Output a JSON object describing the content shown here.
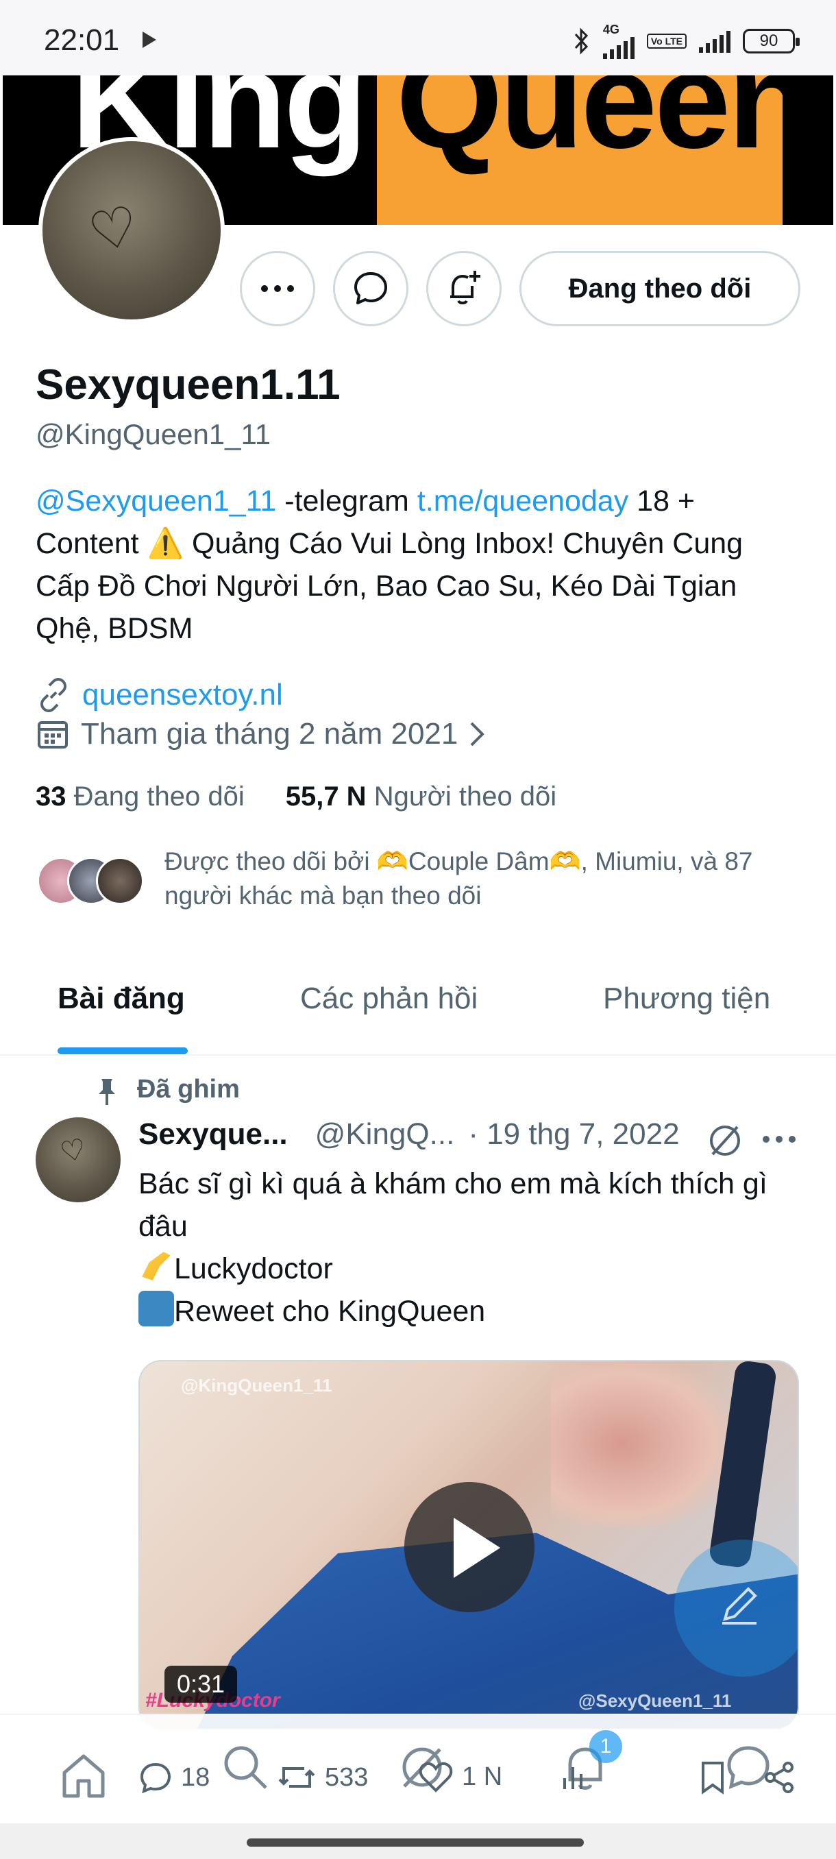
{
  "status_bar": {
    "time": "22:01",
    "net": "4G",
    "volte": "Vo LTE",
    "battery": "90"
  },
  "banner": {
    "left_word": "King",
    "right_word": "Queen"
  },
  "profile": {
    "display_name": "Sexyqueen1.11",
    "handle": "@KingQueen1_11",
    "follow_button": "Đang theo dõi",
    "bio": {
      "mention": "@Sexyqueen1_11",
      "part1": " -telegram  ",
      "link": "t.me/queenoday",
      "part2": " 18 + Content ",
      "warning_emoji": "⚠️",
      "part3": " Quảng Cáo Vui Lòng Inbox! Chuyên Cung Cấp Đồ Chơi Người Lớn, Bao Cao Su, Kéo Dài Tgian Qhệ, BDSM"
    },
    "website": "queensextoy.nl",
    "joined": "Tham gia tháng 2 năm 2021",
    "following_count": "33",
    "following_label": "Đang theo dõi",
    "followers_count": "55,7 N",
    "followers_label": "Người theo dõi",
    "followed_by": "Được theo dõi bởi 🫶Couple Dâm🫶, Miumiu, và 87 người khác mà bạn theo dõi"
  },
  "tabs": [
    {
      "label": "Bài đăng",
      "active": true
    },
    {
      "label": "Các phản hồi",
      "active": false
    },
    {
      "label": "Phương tiện",
      "active": false
    }
  ],
  "pinned_tweet": {
    "pinned_label": "Đã ghim",
    "name": "Sexyque...",
    "handle": "@KingQ...",
    "date": "· 19 thg 7, 2022",
    "line1": "Bác sĩ gì kì quá à khám cho em mà kích thích gì đâu",
    "line2": "Luckydoctor",
    "line3": "Reweet cho KingQueen",
    "video": {
      "watermark_top": "@KingQueen1_11",
      "watermark_bottom": "@SexyQueen1_11",
      "hashtag": "#Luckydoctor",
      "duration": "0:31"
    },
    "replies": "18",
    "retweets": "533",
    "likes": "1 N"
  },
  "bottom_nav": {
    "notification_badge": "1"
  },
  "colors": {
    "accent": "#1d9bf0",
    "secondary_text": "#536471",
    "banner_orange": "#f7a033"
  }
}
